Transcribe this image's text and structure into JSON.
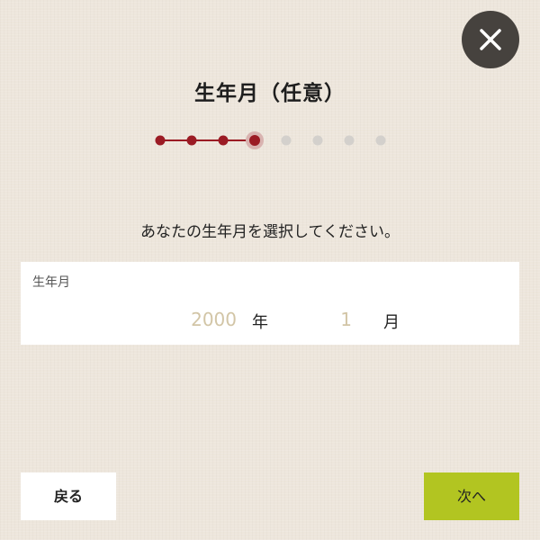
{
  "header": {
    "title": "生年月（任意）",
    "close_icon": "close-icon"
  },
  "stepper": {
    "total_steps": 8,
    "current_step": 4,
    "active_color": "#9b1b24",
    "inactive_color": "#d3d0cc"
  },
  "main": {
    "instruction": "あなたの生年月を選択してください。",
    "field": {
      "label": "生年月",
      "year_value": "2000",
      "year_unit": "年",
      "month_value": "1",
      "month_unit": "月"
    }
  },
  "footer": {
    "back_label": "戻る",
    "next_label": "次へ",
    "next_color": "#b2c521"
  }
}
